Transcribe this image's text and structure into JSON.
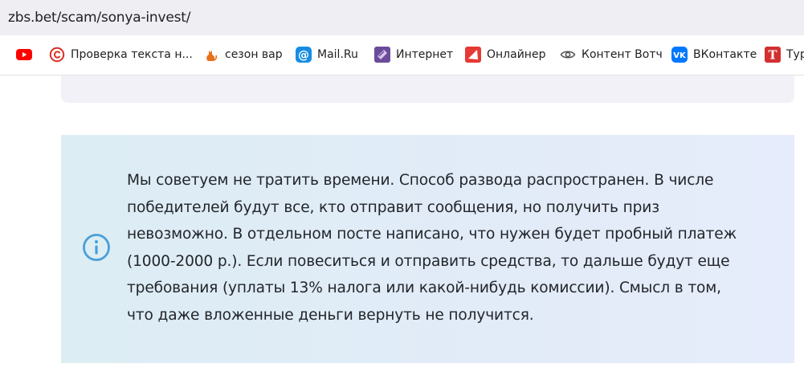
{
  "browser": {
    "url": "zbs.bet/scam/sonya-invest/"
  },
  "bookmarks": [
    {
      "label": "",
      "icon": "youtube-icon",
      "color": "#ff0000"
    },
    {
      "label": "Проверка текста н...",
      "icon": "copyright-icon",
      "color": "#d93025"
    },
    {
      "label": "сезон вар",
      "icon": "cat-icon",
      "color": "#e8711a"
    },
    {
      "label": "Mail.Ru",
      "icon": "mail-ru-icon",
      "color": "#168de2"
    },
    {
      "label": "Интернет",
      "icon": "internet-icon",
      "color": "#6b4c9a"
    },
    {
      "label": "Онлайнер",
      "icon": "onliner-icon",
      "color": "#e53935"
    },
    {
      "label": "Контент Вотч",
      "icon": "eye-icon",
      "color": "#555555"
    },
    {
      "label": "ВКонтакте",
      "icon": "vk-icon",
      "color": "#0077ff"
    },
    {
      "label": "Тур",
      "icon": "t-letter-icon",
      "color": "#d32f2f"
    }
  ],
  "notice": {
    "lines": [
      "Мы советуем не тратить времени. Способ развода распространен. В числе",
      "победителей будут все, кто отправит сообщения, но получить приз",
      "невозможно. В отдельном посте написано, что нужен будет пробный платеж",
      "(1000-2000 р.). Если повеситься и отправить средства, то дальше будут еще",
      "требования (уплаты 13% налога или какой-нибудь комиссии). Смысл в том,",
      "что даже вложенные деньги вернуть не получится."
    ],
    "icon": "info-icon",
    "icon_color": "#4a9fd8"
  }
}
